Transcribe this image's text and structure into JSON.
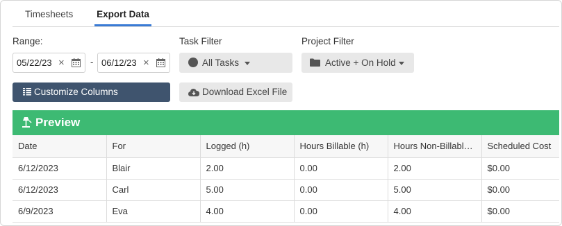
{
  "tabs": [
    {
      "label": "Timesheets",
      "active": false
    },
    {
      "label": "Export Data",
      "active": true
    }
  ],
  "range": {
    "label": "Range:",
    "start": "05/22/23",
    "end": "06/12/23",
    "separator": "-"
  },
  "task_filter": {
    "label": "Task Filter",
    "value": "All Tasks",
    "icon": "circle-icon"
  },
  "project_filter": {
    "label": "Project Filter",
    "value": "Active + On Hold",
    "icon": "folder-icon"
  },
  "buttons": {
    "customize": "Customize Columns",
    "download": "Download Excel File"
  },
  "preview": {
    "title": "Preview",
    "color": "#3dba73"
  },
  "table": {
    "headers": [
      "Date",
      "For",
      "Logged (h)",
      "Hours Billable (h)",
      "Hours Non-Billable (h)",
      "Scheduled Cost"
    ],
    "rows": [
      [
        "6/12/2023",
        "Blair",
        "2.00",
        "0.00",
        "2.00",
        "$0.00"
      ],
      [
        "6/12/2023",
        "Carl",
        "5.00",
        "0.00",
        "5.00",
        "$0.00"
      ],
      [
        "6/9/2023",
        "Eva",
        "4.00",
        "0.00",
        "4.00",
        "$0.00"
      ]
    ]
  },
  "colors": {
    "accent": "#3a7bd5",
    "dark_button": "#3f546e"
  }
}
